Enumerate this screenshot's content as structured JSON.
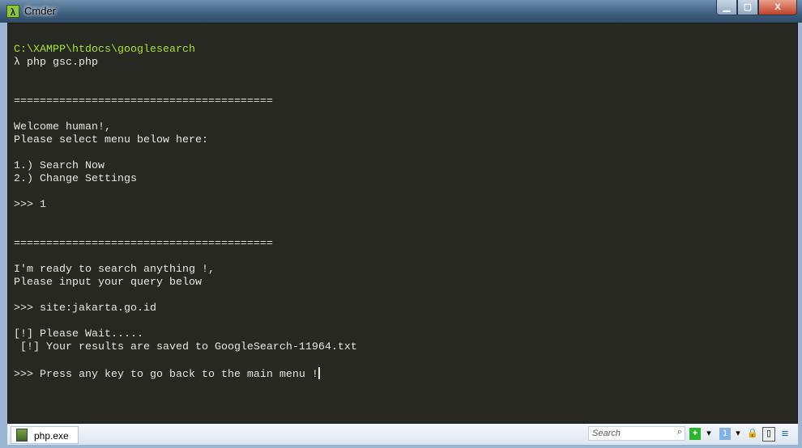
{
  "window": {
    "title": "Cmder",
    "app_icon": "λ",
    "min": "▁",
    "max": "▢",
    "close": "X"
  },
  "terminal": {
    "lines": [
      {
        "text": "C:\\XAMPP\\htdocs\\googlesearch",
        "color": "#a6e22e"
      },
      {
        "text": "λ php gsc.php"
      },
      {
        "text": ""
      },
      {
        "text": ""
      },
      {
        "text": "========================================"
      },
      {
        "text": ""
      },
      {
        "text": "Welcome human!,"
      },
      {
        "text": "Please select menu below here:"
      },
      {
        "text": ""
      },
      {
        "text": "1.) Search Now"
      },
      {
        "text": "2.) Change Settings"
      },
      {
        "text": ""
      },
      {
        "text": ">>> 1"
      },
      {
        "text": ""
      },
      {
        "text": ""
      },
      {
        "text": "========================================"
      },
      {
        "text": ""
      },
      {
        "text": "I'm ready to search anything !,"
      },
      {
        "text": "Please input your query below"
      },
      {
        "text": ""
      },
      {
        "text": ">>> site:jakarta.go.id"
      },
      {
        "text": ""
      },
      {
        "text": "[!] Please Wait....."
      },
      {
        "text": " [!] Your results are saved to GoogleSearch-11964.txt"
      },
      {
        "text": ""
      },
      {
        "text": ">>> Press any key to go back to the main menu !"
      }
    ]
  },
  "statusbar": {
    "tab_label": "php.exe",
    "search_placeholder": "Search",
    "search_icon": "⌕",
    "new_console": "+",
    "console_number": "1",
    "dropdown": "▾",
    "lock": "🔒",
    "layout": "▯",
    "menu": "≡"
  },
  "colors": {
    "background": "#272822",
    "text": "#e8e8e2",
    "prompt_path": "#a6e22e"
  }
}
